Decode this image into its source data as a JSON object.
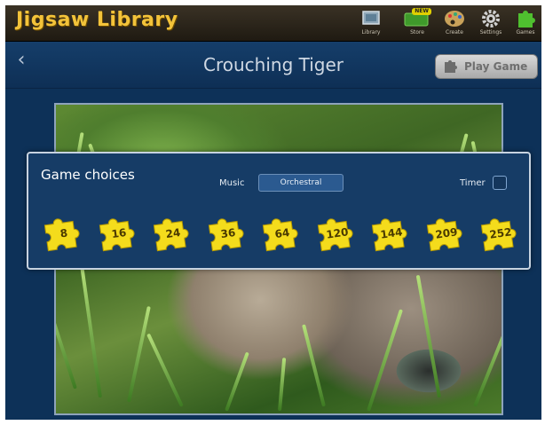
{
  "app": {
    "title": "Jigsaw Library",
    "toolbar": [
      {
        "id": "library",
        "label": "Library",
        "icon": "library-icon"
      },
      {
        "id": "store",
        "label": "Store",
        "icon": "store-icon",
        "badge": "NEW"
      },
      {
        "id": "create",
        "label": "Create",
        "icon": "palette-icon"
      },
      {
        "id": "settings",
        "label": "Settings",
        "icon": "gear-icon"
      },
      {
        "id": "games",
        "label": "Games",
        "icon": "puzzle-piece-icon"
      }
    ]
  },
  "header": {
    "back_icon": "chevron-left-icon",
    "title": "Crouching Tiger",
    "play_button": {
      "label": "Play Game",
      "icon": "puzzle-pieces-icon"
    }
  },
  "choices": {
    "title": "Game choices",
    "music_label": "Music",
    "music_value": "Orchestral",
    "timer_label": "Timer",
    "timer_checked": false,
    "piece_counts": [
      "8",
      "16",
      "24",
      "36",
      "64",
      "120",
      "144",
      "209",
      "252"
    ]
  },
  "colors": {
    "title_yellow": "#f3c33a",
    "panel_bg": "#163c66",
    "background": "#0d3158",
    "piece_yellow": "#f4dc1c"
  }
}
